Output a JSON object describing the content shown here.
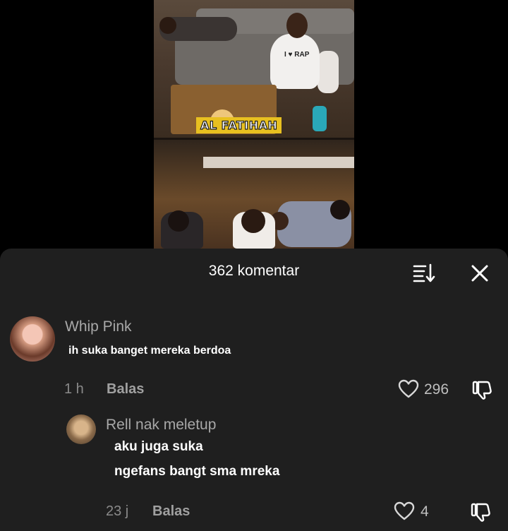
{
  "video": {
    "caption": "AL FATIHAH",
    "shirt_text": "I ♥ RAP"
  },
  "comments_sheet": {
    "title": "362 komentar",
    "sort_icon": "sort-icon",
    "close_icon": "close-icon"
  },
  "comments": [
    {
      "username": "Whip Pink",
      "lines": [
        "ih suka banget mereka berdoa"
      ],
      "time": "1 h",
      "reply_label": "Balas",
      "likes": "296"
    },
    {
      "username": "Rell nak meletup",
      "lines": [
        "aku juga suka",
        "ngefans bangt sma mreka"
      ],
      "time": "23 j",
      "reply_label": "Balas",
      "likes": "4"
    }
  ],
  "colors": {
    "sheet_background": "#1f1f1f",
    "page_background": "#000000",
    "caption_highlight": "#e8c020"
  }
}
